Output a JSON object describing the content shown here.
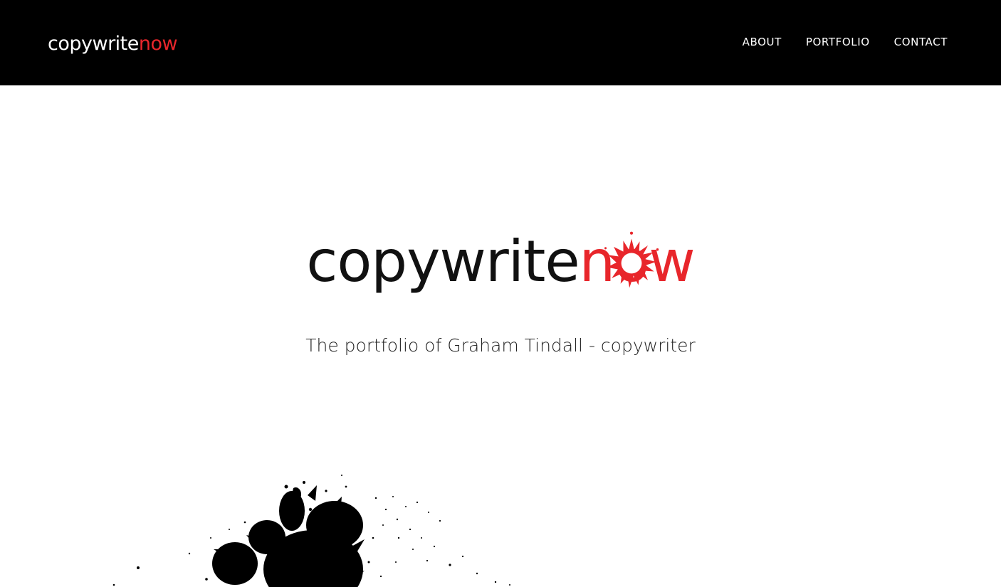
{
  "header": {
    "logo": {
      "text_main": "copywrite",
      "text_accent": "now"
    },
    "nav": [
      {
        "label": "ABOUT"
      },
      {
        "label": "PORTFOLIO"
      },
      {
        "label": "CONTACT"
      }
    ]
  },
  "hero": {
    "logo": {
      "text_main": "copywrite",
      "text_accent_n": "n",
      "text_accent_o": "o",
      "text_accent_w": "w"
    },
    "tagline": "The portfolio of Graham Tindall - copywriter"
  },
  "colors": {
    "header_bg": "#000000",
    "accent_red": "#e8262b",
    "text_dark": "#111111",
    "page_bg": "#ffffff"
  },
  "icons": {
    "logo_o": "ink-splash-icon",
    "decor": "ink-blot-illustration"
  }
}
